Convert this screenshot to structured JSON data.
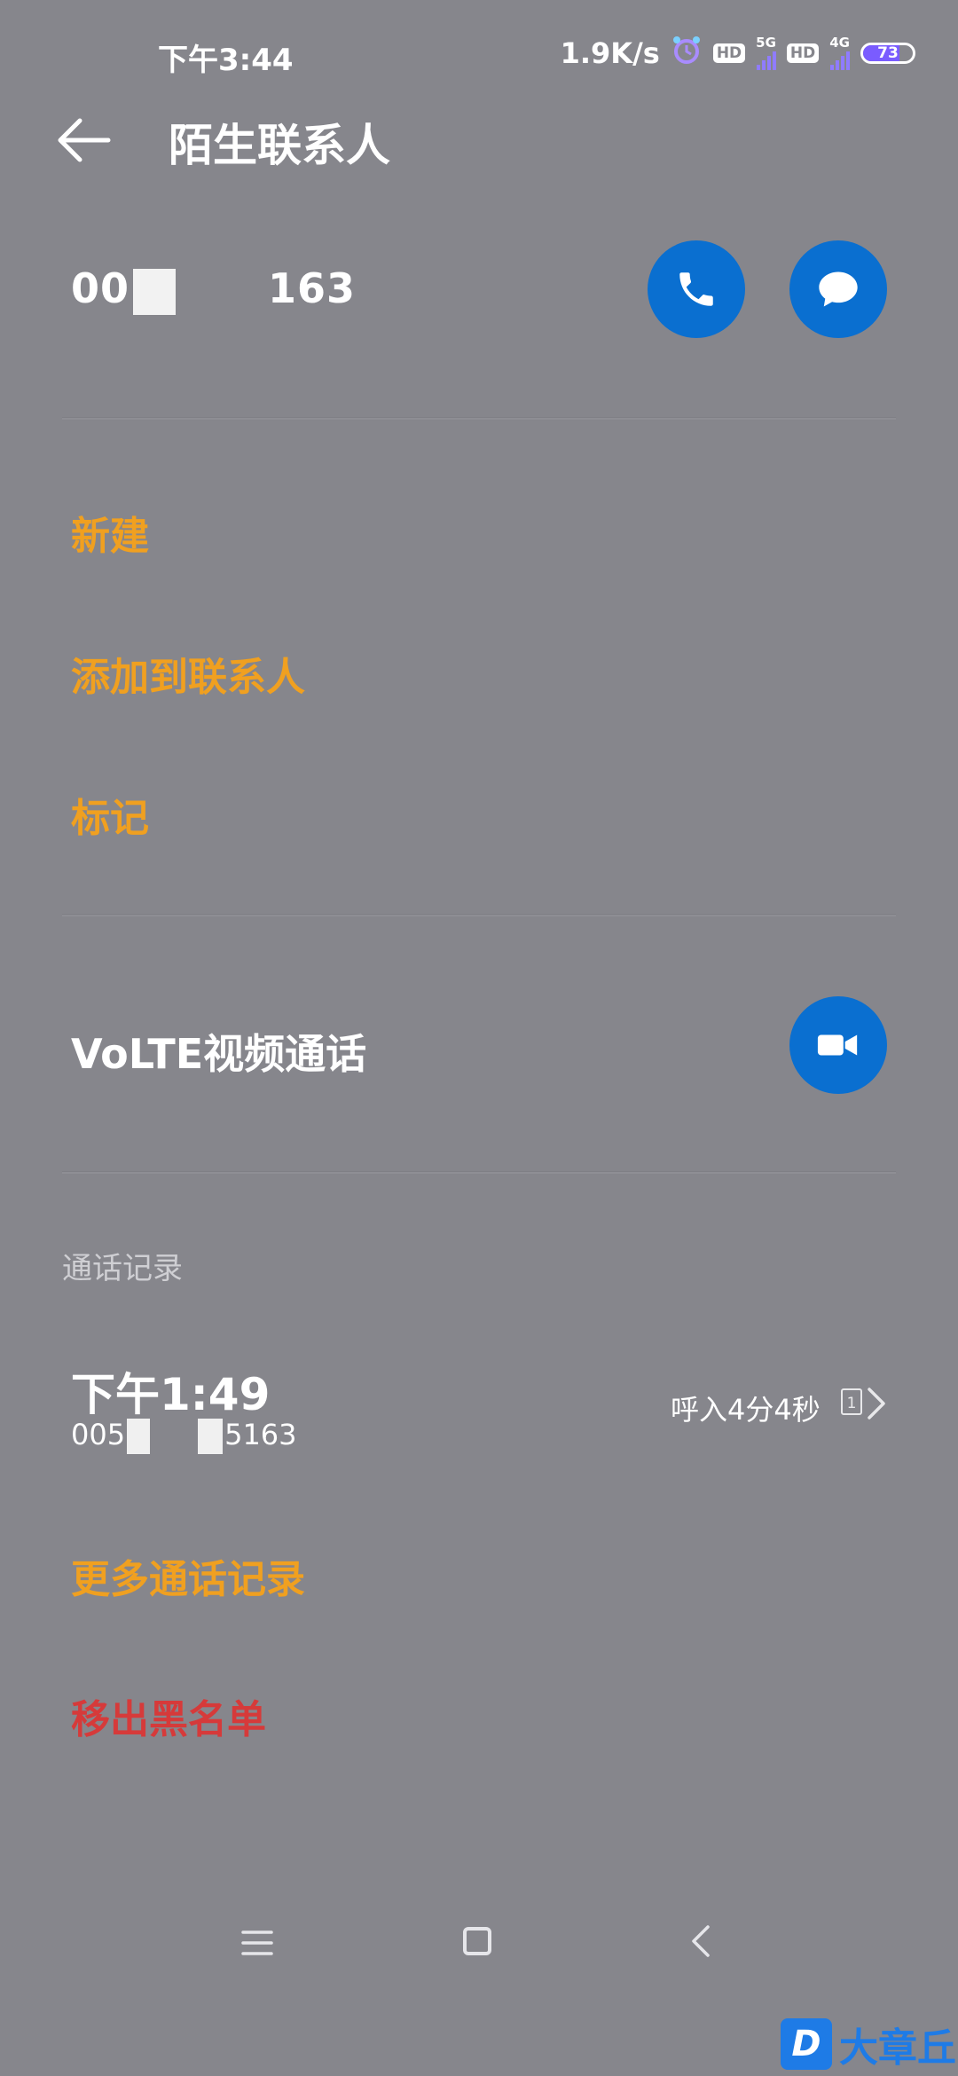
{
  "status_bar": {
    "time": "下午3:44",
    "speed": "1.9K/s",
    "hd_label": "HD",
    "net1": "5G",
    "net2": "4G",
    "battery": "73",
    "battery_level_pct": 73
  },
  "header": {
    "title": "陌生联系人"
  },
  "contact": {
    "number_prefix": "00",
    "number_suffix": "163"
  },
  "menu": {
    "new": "新建",
    "add_to_contacts": "添加到联系人",
    "mark": "标记",
    "volte": "VoLTE视频通话"
  },
  "call_log": {
    "section_label": "通话记录",
    "time": "下午1:49",
    "number_prefix": "005",
    "number_suffix": "5163",
    "duration": "呼入4分4秒",
    "sim": "1",
    "more": "更多通话记录",
    "remove_blacklist": "移出黑名单"
  },
  "watermark": {
    "logo": "D",
    "text": "大章丘"
  },
  "colors": {
    "background": "#86868c",
    "accent_orange": "#f0a020",
    "danger_red": "#d63a3a",
    "action_blue": "#0a6fd0"
  }
}
